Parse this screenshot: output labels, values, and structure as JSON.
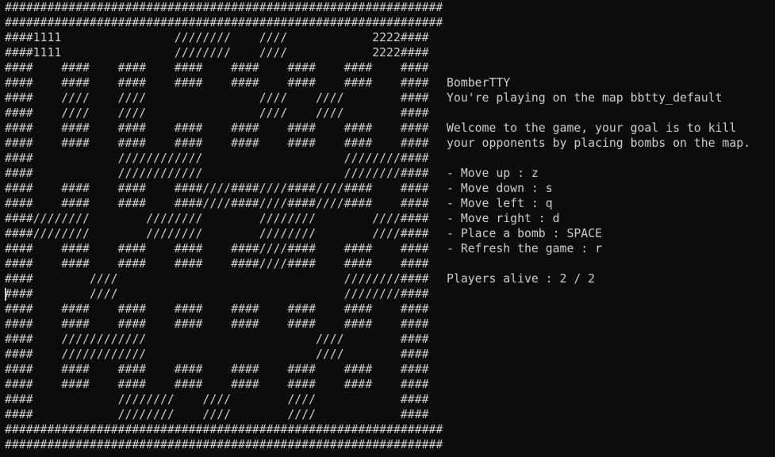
{
  "map_rows": [
    "##############################################################",
    "##############################################################",
    "####1111                ////////    ////            2222####",
    "####1111                ////////    ////            2222####",
    "####    ####    ####    ####    ####    ####    ####    ####",
    "####    ####    ####    ####    ####    ####    ####    ####",
    "####    ////    ////                ////    ////        ####",
    "####    ////    ////                ////    ////        ####",
    "####    ####    ####    ####    ####    ####    ####    ####",
    "####    ####    ####    ####    ####    ####    ####    ####",
    "####            ////////////                    ////////####",
    "####            ////////////                    ////////####",
    "####    ####    ####    ####////####////####////####    ####",
    "####    ####    ####    ####////####////####////####    ####",
    "####////////        ////////        ////////        ////####",
    "####////////        ////////        ////////        ////####",
    "####    ####    ####    ####    ####////####    ####    ####",
    "####    ####    ####    ####    ####////####    ####    ####",
    "####        ////                                ////////####",
    "####        ////                                ////////####",
    "####    ####    ####    ####    ####    ####    ####    ####",
    "####    ####    ####    ####    ####    ####    ####    ####",
    "####    ////////////                        ////        ####",
    "####    ////////////                        ////        ####",
    "####    ####    ####    ####    ####    ####    ####    ####",
    "####    ####    ####    ####    ####    ####    ####    ####",
    "####            ////////    ////        ////            ####",
    "####            ////////    ////        ////            ####",
    "##############################################################",
    "##############################################################"
  ],
  "info": {
    "title": "BomberTTY",
    "map_line": "You're playing on the map bbtty_default",
    "welcome_line1": "Welcome to the game, your goal is to kill",
    "welcome_line2": "your opponents by placing bombs on the map.",
    "controls": [
      "- Move up : z",
      "- Move down : s",
      "- Move left : q",
      "- Move right : d",
      "- Place a bomb : SPACE",
      "- Refresh the game : r"
    ],
    "players_alive": "Players alive : 2 / 2"
  }
}
